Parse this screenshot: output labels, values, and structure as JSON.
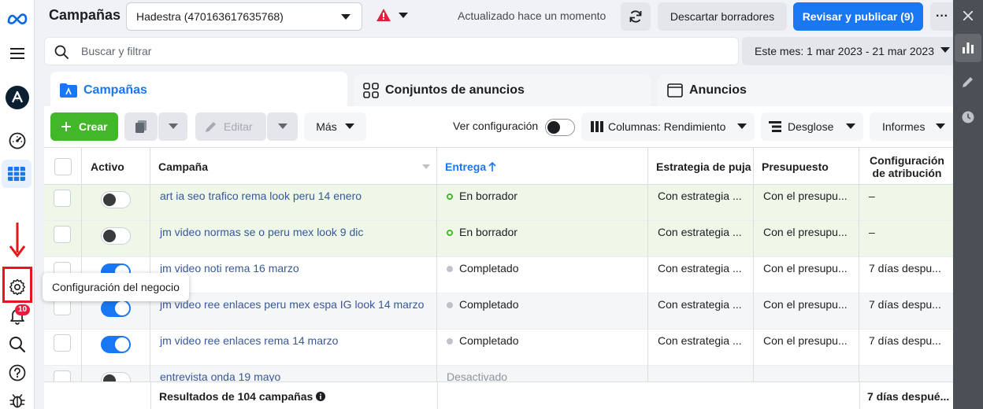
{
  "header": {
    "title": "Campañas",
    "account": "Hadestra (470163617635768)",
    "updated": "Actualizado hace un momento",
    "discard_label": "Descartar borradores",
    "publish_label": "Revisar y publicar (9)",
    "more_label": "···"
  },
  "search": {
    "placeholder": "Buscar y filtrar",
    "date_range": "Este mes: 1 mar 2023 - 21 mar 2023"
  },
  "tabs": [
    {
      "label": "Campañas"
    },
    {
      "label": "Conjuntos de anuncios"
    },
    {
      "label": "Anuncios"
    }
  ],
  "toolbar": {
    "create_label": "Crear",
    "edit_label": "Editar",
    "more_label": "Más",
    "view_config": "Ver configuración",
    "columns_label": "Columnas: Rendimiento",
    "breakdown_label": "Desglose",
    "reports_label": "Informes"
  },
  "table": {
    "headers": {
      "active": "Activo",
      "campaign": "Campaña",
      "delivery": "Entrega",
      "bid_strategy": "Estrategia de puja",
      "budget": "Presupuesto",
      "attribution": "Configuración de atribución"
    },
    "rows": [
      {
        "on": false,
        "name": "art ia seo trafico rema look peru 14 enero",
        "status": "En borrador",
        "status_kind": "draft",
        "bid": "Con estrategia ...",
        "budget": "Con el presupu...",
        "attribution": "–"
      },
      {
        "on": false,
        "name": "jm video normas se o peru mex look 9 dic",
        "status": "En borrador",
        "status_kind": "draft",
        "bid": "Con estrategia ...",
        "budget": "Con el presupu...",
        "attribution": "–"
      },
      {
        "on": true,
        "name": "jm video noti rema 16 marzo",
        "status": "Completado",
        "status_kind": "done",
        "bid": "Con estrategia ...",
        "budget": "Con el presupu...",
        "attribution": "7 días despu..."
      },
      {
        "on": true,
        "name": "jm video ree enlaces peru mex espa IG look 14 marzo",
        "status": "Completado",
        "status_kind": "done",
        "bid": "Con estrategia ...",
        "budget": "Con el presupu...",
        "attribution": "7 días despu..."
      },
      {
        "on": true,
        "name": "jm video ree enlaces rema 14 marzo",
        "status": "Completado",
        "status_kind": "done",
        "bid": "Con estrategia ...",
        "budget": "Con el presupu...",
        "attribution": "7 días despu..."
      },
      {
        "on": false,
        "name": "entrevista onda 19 mayo",
        "status": "Desactivado",
        "status_kind": "off",
        "bid": "",
        "budget": "",
        "attribution": ""
      }
    ],
    "footer_label": "Resultados de 104 campañas",
    "footer_attribution": "7 días despué..."
  },
  "tooltip": "Configuración del negocio",
  "notifications_count": "10",
  "colors": {
    "primary": "#1877f2",
    "create": "#42b72a",
    "highlight": "#e8161a"
  }
}
